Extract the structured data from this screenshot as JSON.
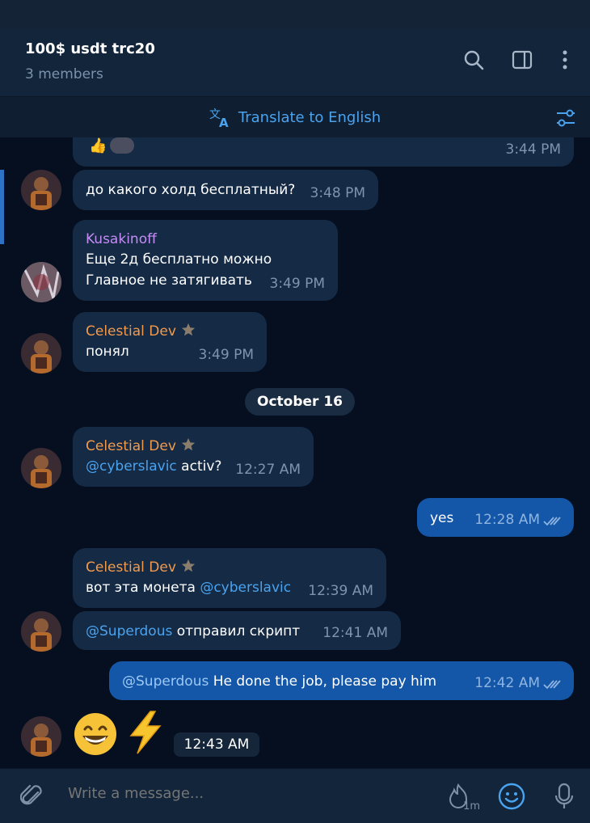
{
  "header": {
    "title": "100$ usdt trc20",
    "subtitle": "3 members",
    "icons": [
      "search-icon",
      "sidebar-toggle-icon",
      "more-vertical-icon"
    ]
  },
  "translate": {
    "label": "Translate to English",
    "icon": "translate-icon",
    "settings_icon": "filter-settings-icon"
  },
  "messages": [
    {
      "id": "m0",
      "reactions": "👍",
      "time": "3:44 PM",
      "outgoing": false
    },
    {
      "id": "m1",
      "text": "до какого холд бесплатный?",
      "time": "3:48 PM",
      "outgoing": false
    },
    {
      "id": "m2",
      "sender": "Kusakinoff",
      "lines": [
        "Еще 2д бесплатно можно",
        "Главное не затягивать"
      ],
      "time": "3:49 PM",
      "outgoing": false
    },
    {
      "id": "m3",
      "sender": "Celestial Dev",
      "text": "понял",
      "time": "3:49 PM",
      "outgoing": false
    },
    {
      "id": "m4",
      "sender": "Celestial Dev",
      "mention": "@cyberslavic",
      "text": " activ?",
      "time": "12:27 AM",
      "outgoing": false
    },
    {
      "id": "m5",
      "text": "yes",
      "time": "12:28 AM",
      "outgoing": true
    },
    {
      "id": "m6",
      "sender": "Celestial Dev",
      "text": "вот эта монета ",
      "mention": "@cyberslavic",
      "time": "12:39 AM",
      "outgoing": false
    },
    {
      "id": "m7",
      "mention": "@Superdous",
      "text": " отправил скрипт",
      "time": "12:41 AM",
      "outgoing": false
    },
    {
      "id": "m8",
      "mention": "@Superdous",
      "text": " He done the job, please pay him",
      "time": "12:42 AM",
      "outgoing": true
    },
    {
      "id": "m9",
      "emojis": [
        "😁",
        "⚡"
      ],
      "time": "12:43 AM",
      "outgoing": false
    }
  ],
  "date_separator": "October 16",
  "composer": {
    "placeholder": "Write a message...",
    "slowmode_label": "1m",
    "icons": [
      "attach-icon",
      "slowmode-fire-icon",
      "emoji-icon",
      "microphone-icon"
    ]
  },
  "colors": {
    "accent": "#4aa3ef",
    "sender_orange": "#f39a4c",
    "sender_purple": "#c68cf5",
    "outgoing_bubble": "#1457a8",
    "incoming_bubble": "#142a45"
  }
}
